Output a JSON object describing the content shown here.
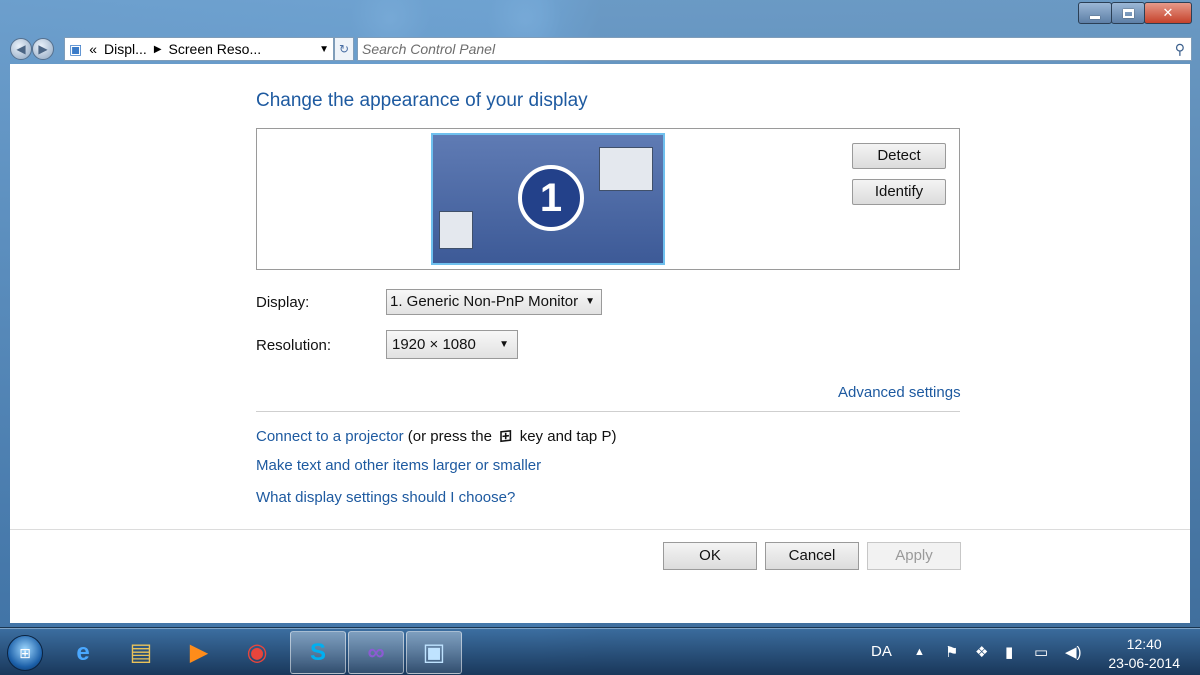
{
  "window": {
    "address": {
      "overflow": "«",
      "crumb1": "Displ...",
      "crumb2": "Screen Reso...",
      "dropdown_icon": "chevron-down-icon",
      "refresh_icon": "refresh-icon"
    },
    "search": {
      "placeholder": "Search Control Panel",
      "icon": "search-icon"
    }
  },
  "content": {
    "title": "Change the appearance of your display",
    "monitor_number": "1",
    "detect_label": "Detect",
    "identify_label": "Identify",
    "display_label": "Display:",
    "display_value": "1. Generic Non-PnP Monitor",
    "resolution_label": "Resolution:",
    "resolution_value": "1920 × 1080",
    "advanced_link": "Advanced settings",
    "projector_link": "Connect to a projector",
    "projector_text_before": "(or press the",
    "projector_text_after": "key and tap P)",
    "text_size_link": "Make text and other items larger or smaller",
    "help_link": "What display settings should I choose?",
    "ok_label": "OK",
    "cancel_label": "Cancel",
    "apply_label": "Apply"
  },
  "taskbar": {
    "apps": [
      "internet-explorer-icon",
      "file-explorer-icon",
      "media-player-icon",
      "chrome-icon",
      "skype-icon",
      "visual-studio-icon",
      "control-panel-icon"
    ],
    "language": "DA",
    "time": "12:40",
    "date": "23-06-2014"
  },
  "colors": {
    "link": "#1e5aa0",
    "monitor_border": "#6fc0ee"
  }
}
